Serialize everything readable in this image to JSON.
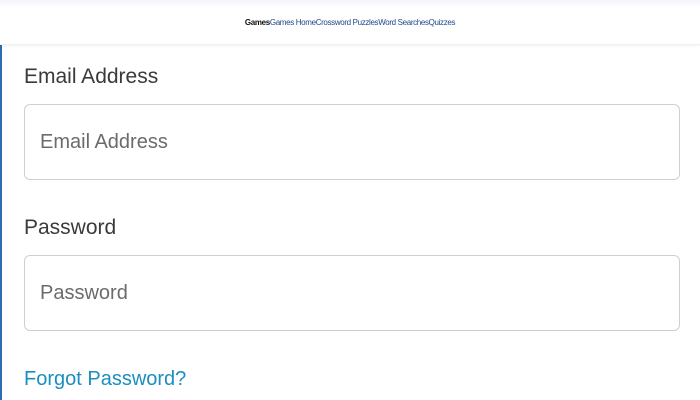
{
  "nav": {
    "label": "Games",
    "links": [
      "Games Home",
      "Crossword Puzzles",
      "Word Searches",
      "Quizzes"
    ]
  },
  "form": {
    "email": {
      "label": "Email Address",
      "placeholder": "Email Address",
      "value": ""
    },
    "password": {
      "label": "Password",
      "placeholder": "Password",
      "value": ""
    },
    "forgot_password": "Forgot Password?"
  },
  "colors": {
    "link": "#1a8fbf",
    "nav_link": "#1a4a8a",
    "border": "#cfcfcf",
    "accent_bar": "#2a6db5"
  }
}
